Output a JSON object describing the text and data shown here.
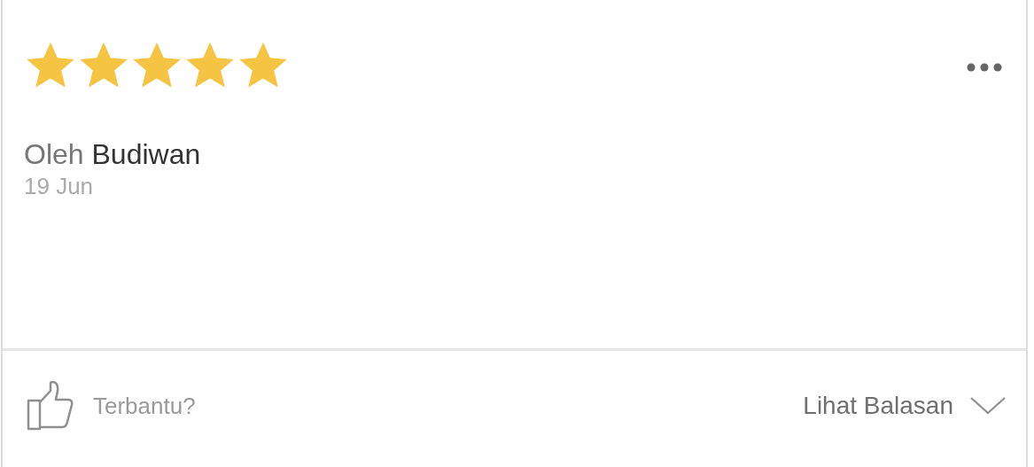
{
  "review": {
    "stars": 5,
    "byline": "Oleh **Budiwan**",
    "date": "19 Jun"
  },
  "footer": {
    "helpful_label": "Terbantu?",
    "replies_label": "Lihat Balasan",
    "replies_expanded": false
  }
}
